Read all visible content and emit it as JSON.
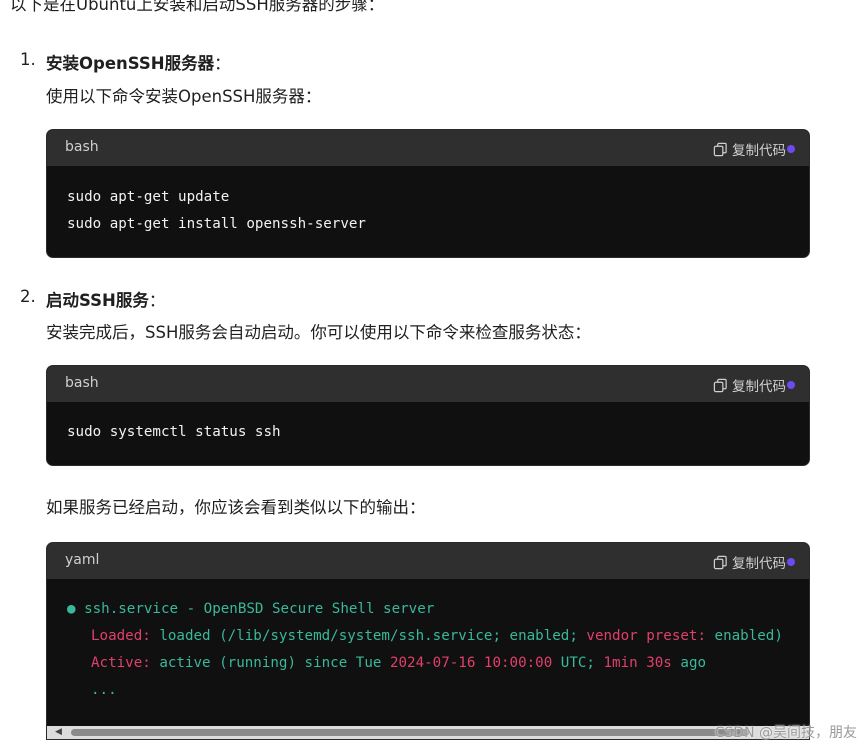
{
  "intro": "以下是在Ubuntu上安装和启动SSH服务器的步骤：",
  "steps": [
    {
      "number": "1.",
      "title": "安装OpenSSH服务器",
      "colon": "：",
      "desc": "使用以下命令安装OpenSSH服务器："
    },
    {
      "number": "2.",
      "title": "启动SSH服务",
      "colon": "：",
      "desc": "安装完成后，SSH服务会自动启动。你可以使用以下命令来检查服务状态："
    }
  ],
  "after_text": "如果服务已经启动，你应该会看到类似以下的输出：",
  "copy_label": "复制代码",
  "code_blocks": [
    {
      "lang": "bash",
      "lines": [
        "sudo apt-get update",
        "sudo apt-get install openssh-server"
      ]
    },
    {
      "lang": "bash",
      "lines": [
        "sudo systemctl status ssh"
      ]
    },
    {
      "lang": "yaml",
      "l1": "● ssh.service - OpenBSD Secure Shell server",
      "l2a": "Loaded:",
      "l2b": " loaded (/lib/systemd/system/ssh.service; enabled; ",
      "l2c": "vendor preset:",
      "l2d": " enabled)",
      "l3a": "Active:",
      "l3b": " active (running) since Tue ",
      "l3c": "2024-07-16 10:00:00",
      "l3d": " UTC; ",
      "l3e": "1min 30s",
      "l3f": " ago",
      "l4": "..."
    }
  ],
  "watermark": "CSDN @吴间技，朋友",
  "colors": {
    "code_bg": "#101010",
    "header_bg": "#2f2f2f",
    "green": "#39b89a",
    "red": "#e0406a",
    "accent_dot": "#6d4af0"
  }
}
